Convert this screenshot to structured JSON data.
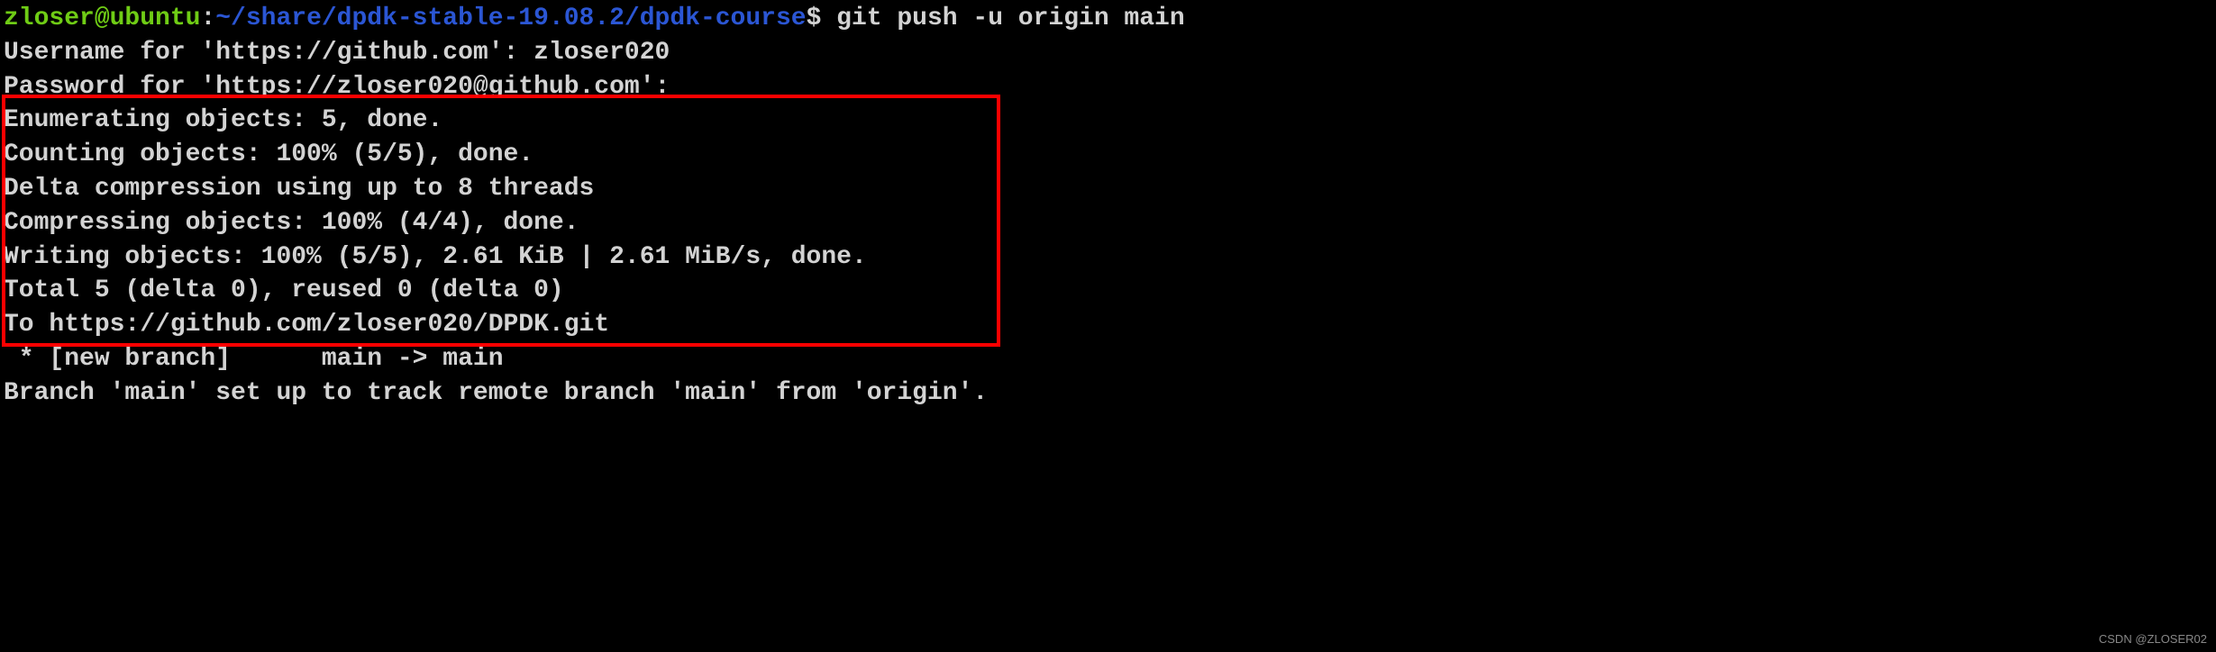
{
  "prompt": {
    "user": "zloser@ubuntu",
    "colon": ":",
    "path": "~/share/dpdk-stable-19.08.2/dpdk-course",
    "dollar": "$ ",
    "command": "git push -u origin main"
  },
  "lines": {
    "username_prompt": "Username for 'https://github.com': zloser020",
    "password_prompt": "Password for 'https://zloser020@github.com':",
    "enum_objects": "Enumerating objects: 5, done.",
    "count_objects": "Counting objects: 100% (5/5), done.",
    "delta_compression": "Delta compression using up to 8 threads",
    "compress_objects": "Compressing objects: 100% (4/4), done.",
    "writing_objects": "Writing objects: 100% (5/5), 2.61 KiB | 2.61 MiB/s, done.",
    "total": "Total 5 (delta 0), reused 0 (delta 0)",
    "to_repo": "To https://github.com/zloser020/DPDK.git",
    "new_branch": " * [new branch]      main -> main",
    "branch_set": "Branch 'main' set up to track remote branch 'main' from 'origin'."
  },
  "watermark": "CSDN @ZLOSER02"
}
